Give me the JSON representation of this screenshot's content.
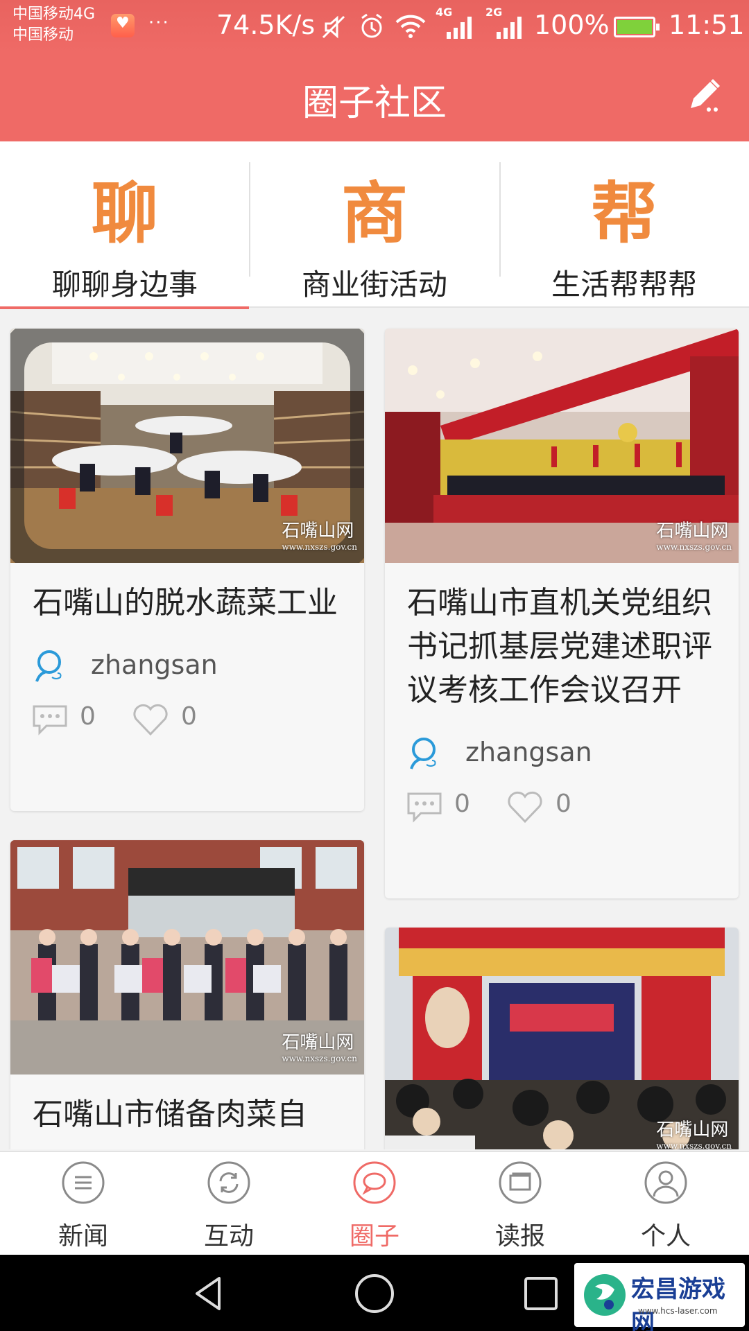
{
  "status_bar": {
    "carrier_1": "中国移动4G",
    "carrier_2": "中国移动",
    "more": "···",
    "net_speed": "74.5K/s",
    "network_1": "4G",
    "network_2": "2G",
    "battery": "100%",
    "time": "11:51"
  },
  "header": {
    "title": "圈子社区",
    "edit_icon": "edit-pencil-icon"
  },
  "categories": [
    {
      "glyph": "聊",
      "label": "聊聊身边事",
      "active": true
    },
    {
      "glyph": "商",
      "label": "商业街活动",
      "active": false
    },
    {
      "glyph": "帮",
      "label": "生活帮帮帮",
      "active": false
    }
  ],
  "posts": [
    {
      "title": "石嘴山的脱水蔬菜工业",
      "author": "zhangsan",
      "comments": "0",
      "likes": "0",
      "watermark": "石嘴山网",
      "watermark_url": "www.nxszs.gov.cn"
    },
    {
      "title": "石嘴山市直机关党组织书记抓基层党建述职评议考核工作会议召开",
      "author": "zhangsan",
      "comments": "0",
      "likes": "0",
      "watermark": "石嘴山网",
      "watermark_url": "www.nxszs.gov.cn"
    },
    {
      "title": "石嘴山市储备肉菜自",
      "author": "",
      "comments": "",
      "likes": "",
      "watermark": "石嘴山网",
      "watermark_url": "www.nxszs.gov.cn"
    },
    {
      "title": "",
      "author": "",
      "comments": "",
      "likes": "",
      "watermark": "石嘴山网",
      "watermark_url": "www.nxszs.gov.cn"
    }
  ],
  "bottom_nav": [
    {
      "label": "新闻",
      "icon": "news-list-icon",
      "active": false
    },
    {
      "label": "互动",
      "icon": "refresh-icon",
      "active": false
    },
    {
      "label": "圈子",
      "icon": "chat-bubble-icon",
      "active": true
    },
    {
      "label": "读报",
      "icon": "newspaper-icon",
      "active": false
    },
    {
      "label": "个人",
      "icon": "person-icon",
      "active": false
    }
  ],
  "system_nav": {
    "back": "back-icon",
    "home": "home-icon",
    "recents": "recents-icon"
  },
  "brand": {
    "name": "宏昌游戏网",
    "url": "www.hcs-laser.com"
  },
  "colors": {
    "accent": "#ef6a66",
    "category_glyph": "#f08a3e",
    "author_avatar": "#2b9ad9"
  }
}
